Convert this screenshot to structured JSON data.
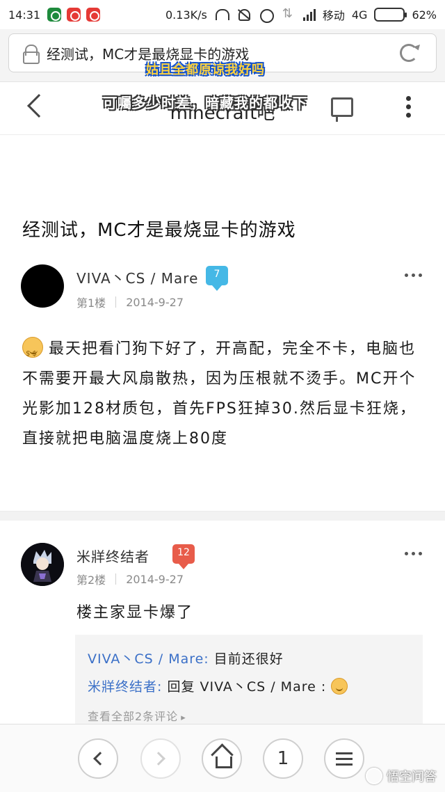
{
  "status_bar": {
    "time": "14:31",
    "speed": "0.13K/s",
    "carrier": "移动",
    "network": "4G",
    "battery": "62%",
    "battery_level": 0.62
  },
  "browser": {
    "url_text": "经测试，MC才是最烧显卡的游戏"
  },
  "captions": {
    "line1": "姑且全都原谅我好吗",
    "line2": "可囑多少时差，暗藏我的都收下"
  },
  "header": {
    "title": "minecraft吧"
  },
  "post": {
    "title": "经测试，MC才是最烧显卡的游戏",
    "floor1": {
      "user": "VIVA丶CS / Mare",
      "level": "7",
      "floor": "第1楼",
      "date": "2014-9-27",
      "content": "最天把看门狗下好了，开高配，完全不卡，电脑也不需要开最大风扇散热，因为压根就不烫手。MC开个光影加128材质包，首先FPS狂掉30.然后显卡狂烧，直接就把电脑温度烧上80度"
    },
    "floor2": {
      "user": "米牂终结者",
      "level": "12",
      "floor": "第2楼",
      "date": "2014-9-27",
      "content": "楼主家显卡爆了",
      "subcomments": [
        {
          "who": "VIVA丶CS / Mare:",
          "text": " 目前还很好"
        },
        {
          "who": "米牂终结者:",
          "text": " 回复 VIVA丶CS / Mare : "
        }
      ],
      "view_all": "查看全部2条评论"
    }
  },
  "toolbar": {
    "tab_count": "1"
  },
  "watermark": "悟空问答",
  "colors": {
    "link_blue": "#3a6fc7",
    "badge_blue": "#45b8e6",
    "badge_red": "#e85c4a"
  }
}
